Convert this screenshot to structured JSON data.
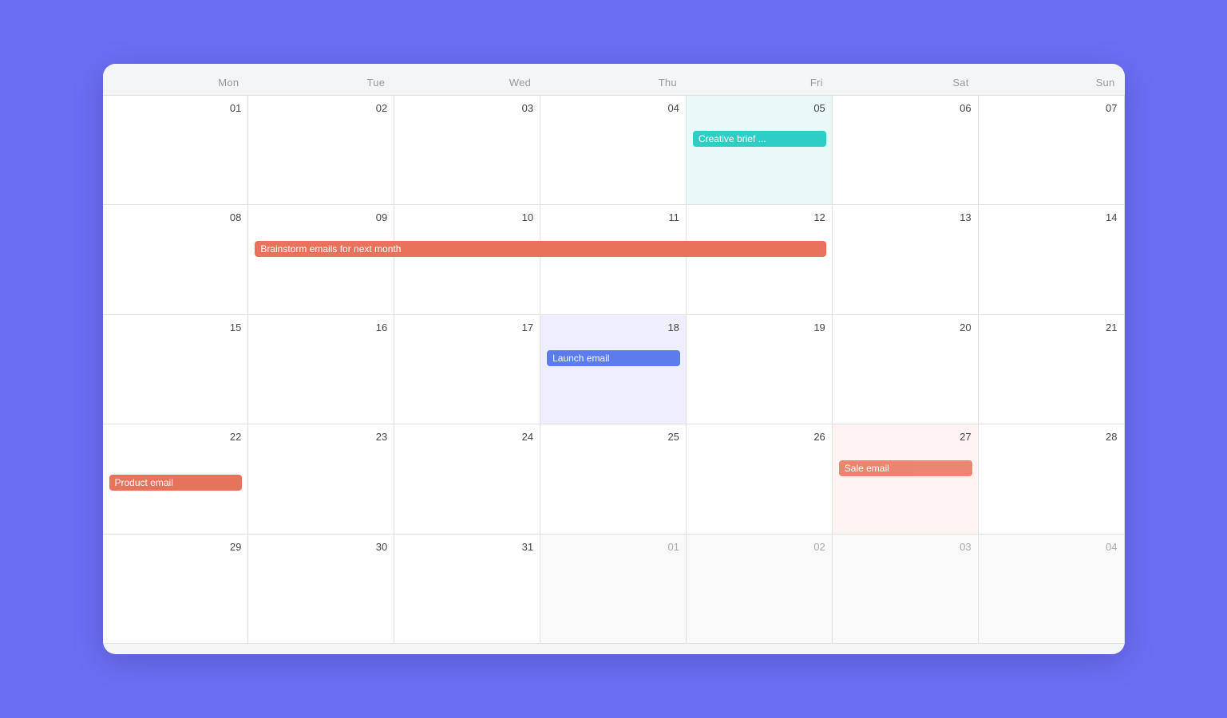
{
  "calendar": {
    "days_of_week": [
      "Mon",
      "Tue",
      "Wed",
      "Thu",
      "Fri",
      "Sat",
      "Sun"
    ],
    "weeks": [
      [
        {
          "date": "01",
          "month": "current",
          "highlight": ""
        },
        {
          "date": "02",
          "month": "current",
          "highlight": ""
        },
        {
          "date": "03",
          "month": "current",
          "highlight": ""
        },
        {
          "date": "04",
          "month": "current",
          "highlight": ""
        },
        {
          "date": "05",
          "month": "current",
          "highlight": "fri"
        },
        {
          "date": "06",
          "month": "current",
          "highlight": ""
        },
        {
          "date": "07",
          "month": "current",
          "highlight": ""
        }
      ],
      [
        {
          "date": "08",
          "month": "current",
          "highlight": ""
        },
        {
          "date": "09",
          "month": "current",
          "highlight": ""
        },
        {
          "date": "10",
          "month": "current",
          "highlight": ""
        },
        {
          "date": "11",
          "month": "current",
          "highlight": ""
        },
        {
          "date": "12",
          "month": "current",
          "highlight": ""
        },
        {
          "date": "13",
          "month": "current",
          "highlight": ""
        },
        {
          "date": "14",
          "month": "current",
          "highlight": ""
        }
      ],
      [
        {
          "date": "15",
          "month": "current",
          "highlight": ""
        },
        {
          "date": "16",
          "month": "current",
          "highlight": ""
        },
        {
          "date": "17",
          "month": "current",
          "highlight": ""
        },
        {
          "date": "18",
          "month": "current",
          "highlight": "launch"
        },
        {
          "date": "19",
          "month": "current",
          "highlight": ""
        },
        {
          "date": "20",
          "month": "current",
          "highlight": ""
        },
        {
          "date": "21",
          "month": "current",
          "highlight": ""
        }
      ],
      [
        {
          "date": "22",
          "month": "current",
          "highlight": ""
        },
        {
          "date": "23",
          "month": "current",
          "highlight": ""
        },
        {
          "date": "24",
          "month": "current",
          "highlight": ""
        },
        {
          "date": "25",
          "month": "current",
          "highlight": ""
        },
        {
          "date": "26",
          "month": "current",
          "highlight": ""
        },
        {
          "date": "27",
          "month": "current",
          "highlight": "sale"
        },
        {
          "date": "28",
          "month": "current",
          "highlight": ""
        }
      ],
      [
        {
          "date": "29",
          "month": "current",
          "highlight": ""
        },
        {
          "date": "30",
          "month": "current",
          "highlight": ""
        },
        {
          "date": "31",
          "month": "current",
          "highlight": ""
        },
        {
          "date": "01",
          "month": "other",
          "highlight": ""
        },
        {
          "date": "02",
          "month": "other",
          "highlight": ""
        },
        {
          "date": "03",
          "month": "other",
          "highlight": ""
        },
        {
          "date": "04",
          "month": "other",
          "highlight": ""
        }
      ]
    ],
    "events": {
      "creative_brief": "Creative brief ...",
      "brainstorm": "Brainstorm emails for next month",
      "launch_email": "Launch email",
      "product_email": "Product email",
      "sale_email": "Sale email"
    }
  }
}
